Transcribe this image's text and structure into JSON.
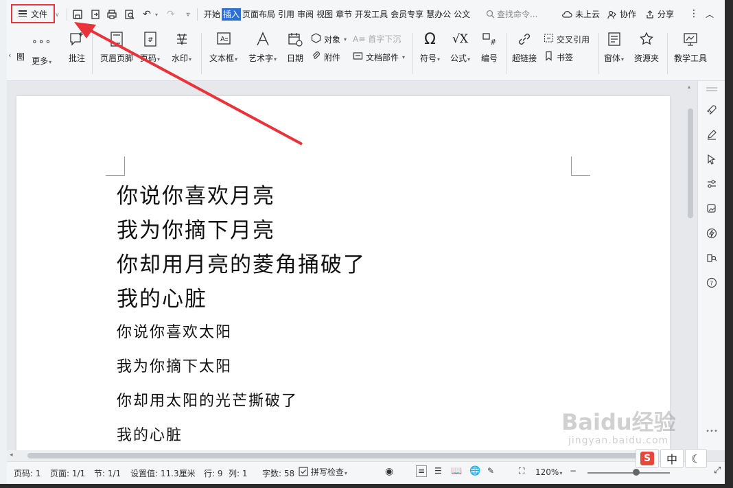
{
  "toolbar": {
    "file_label": "文件",
    "tabs": [
      "开始",
      "插入",
      "页面布局",
      "引用",
      "审阅",
      "视图",
      "章节",
      "开发工具",
      "会员专享",
      "慧办公",
      "公文"
    ],
    "search_placeholder": "查找命令...",
    "cloud_label": "未上云",
    "collab_label": "协作",
    "share_label": "分享"
  },
  "ribbon": {
    "items": [
      "图",
      "更多",
      "批注",
      "页眉页脚",
      "页码",
      "水印",
      "文本框",
      "艺术字",
      "日期",
      "对象",
      "首字下沉",
      "附件",
      "文档部件",
      "符号",
      "公式",
      "编号",
      "超链接",
      "交叉引用",
      "书签",
      "窗体",
      "资源夹",
      "教学工具"
    ]
  },
  "document": {
    "lines": [
      "你说你喜欢月亮",
      "我为你摘下月亮",
      "你却用月亮的菱角捅破了",
      "我的心脏",
      "你说你喜欢太阳",
      "我为你摘下太阳",
      "你却用太阳的光芒撕破了",
      "我的心脏"
    ]
  },
  "status": {
    "page_no": "页码: 1",
    "pages": "页面: 1/1",
    "section": "节: 1/1",
    "setting": "设置值: 11.3厘米",
    "row": "行: 9",
    "col": "列: 1",
    "word_count": "字数: 58",
    "spell_check": "拼写检查",
    "zoom": "120%"
  },
  "ime": {
    "mode": "中"
  },
  "watermark": {
    "brand": "Baidu经验",
    "url": "jingyan.baidu.com"
  },
  "colors": {
    "highlight_red": "#e8333a",
    "active_tab": "#2e6fd6"
  }
}
